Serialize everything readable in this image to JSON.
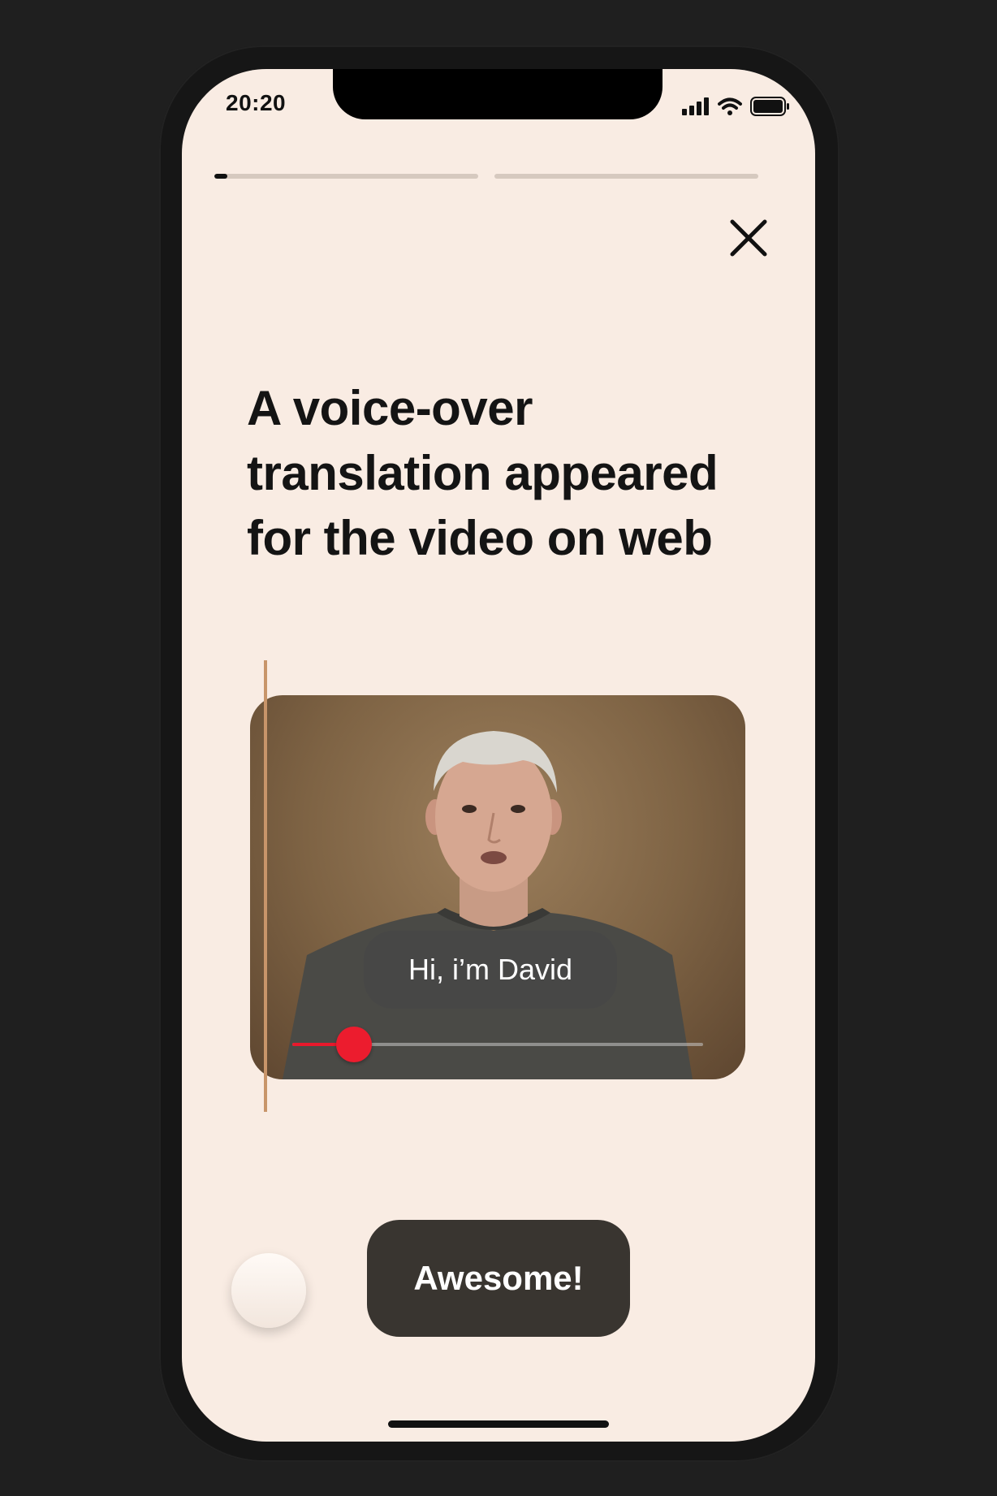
{
  "status_bar": {
    "time": "20:20"
  },
  "progress": {
    "segments": [
      0.05,
      0.0
    ]
  },
  "headline": "A voice-over translation appeared for the video on web",
  "video": {
    "subtitle": "Hi, i’m David",
    "playback_progress": 0.15,
    "accent_color": "#e8192c"
  },
  "actions": {
    "cta_label": "Awesome!"
  },
  "icons": {
    "close": "close-icon",
    "signal": "cellular-signal-icon",
    "wifi": "wifi-icon",
    "battery": "battery-icon"
  }
}
